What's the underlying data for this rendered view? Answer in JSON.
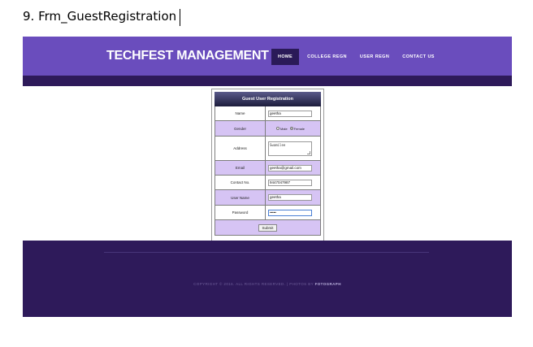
{
  "doc": {
    "caption": "9. Frm_GuestRegistration"
  },
  "site": {
    "logo": "TECHFEST MANAGEMENT SYSTEM",
    "nav": [
      {
        "label": "HOME",
        "active": true
      },
      {
        "label": "COLLEGE REGN",
        "active": false
      },
      {
        "label": "USER REGN",
        "active": false
      },
      {
        "label": "CONTACT US",
        "active": false
      }
    ]
  },
  "form": {
    "title": "Guest User Registration",
    "name": {
      "label": "Name",
      "value": "geetha"
    },
    "gender": {
      "label": "Gender",
      "options": [
        "Male",
        "Female"
      ],
      "selected": "Female"
    },
    "address": {
      "label": "Address",
      "value": "Swamilee"
    },
    "email": {
      "label": "Email",
      "value": "geetha@gmail.com"
    },
    "contact": {
      "label": "Contact No.",
      "value": "9447047987"
    },
    "username": {
      "label": "User Name",
      "value": "geetha"
    },
    "password": {
      "label": "Password",
      "value": "•••••"
    },
    "submit_label": "Submit"
  },
  "footer": {
    "copyright": "COPYRIGHT © 2016. ALL RIGHTS RESERVED. | PHOTOS BY",
    "brand": "FOTOGRAPH"
  },
  "colors": {
    "header": "#6a4dbd",
    "dark_purple": "#2e1a5a",
    "row_alt": "#d6c4f4"
  }
}
